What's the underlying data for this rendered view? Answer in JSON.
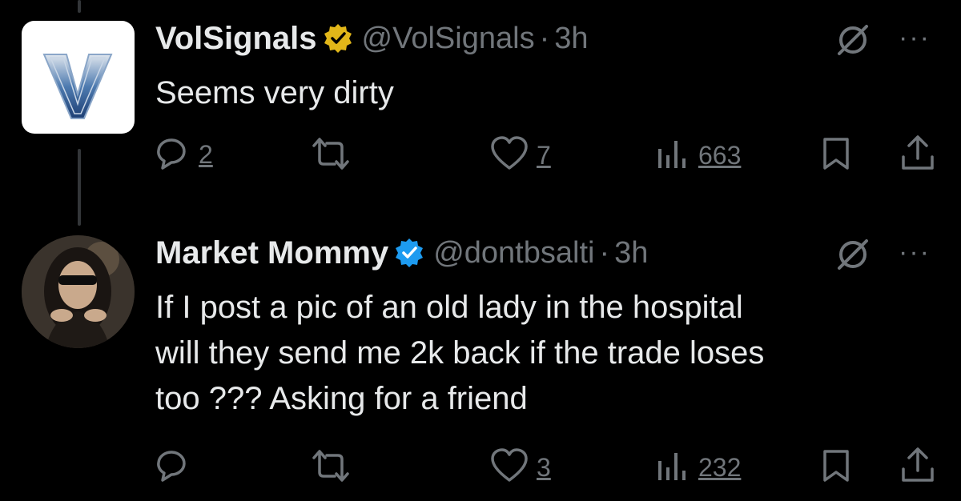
{
  "tweets": [
    {
      "display_name": "VolSignals",
      "handle": "@VolSignals",
      "separator": "·",
      "time": "3h",
      "verified_badge_color": "#e2b719",
      "avatar_letter": "V",
      "text": "Seems very dirty",
      "replies": "2",
      "likes": "7",
      "views": "663"
    },
    {
      "display_name": "Market Mommy",
      "handle": "@dontbsalti",
      "separator": "·",
      "time": "3h",
      "verified_badge_color": "#1d9bf0",
      "text_lines": [
        "If I post a pic of an old lady in the hospital",
        "will they send me 2k back if the trade loses",
        "too ??? Asking for a friend"
      ],
      "likes": "3",
      "views": "232"
    }
  ],
  "more_label": "···",
  "colors": {
    "background": "#000000",
    "text": "#e7e9ea",
    "muted": "#71767b",
    "gold": "#e2b719",
    "blue": "#1d9bf0"
  },
  "icons": [
    "reply-icon",
    "retweet-icon",
    "like-icon",
    "views-icon",
    "bookmark-icon",
    "share-icon",
    "grok-icon",
    "more-icon"
  ]
}
